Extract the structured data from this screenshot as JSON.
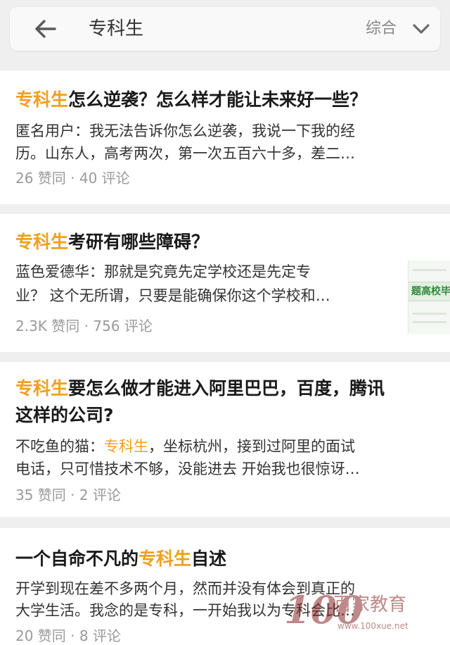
{
  "search": {
    "query": "专科生",
    "sort_label": "综合",
    "icons": {
      "back": "arrow-left-icon",
      "sort": "chevron-down-icon"
    }
  },
  "colors": {
    "highlight": "#f0a020",
    "meta": "#9a9a9a",
    "background": "#efefef"
  },
  "results": [
    {
      "title_highlight": "专科生",
      "title_rest": "怎么逆袭？怎么样才能让未来好一些？",
      "excerpt_line1": "匿名用户：我无法告诉你怎么逆袭，我说一下我的经",
      "excerpt_line2": "历。山东人，高考两次，第一次五百六十多，差二…",
      "meta": "26 赞同 · 40 评论"
    },
    {
      "title_highlight": "专科生",
      "title_rest": "考研有哪些障碍？",
      "excerpt_line1": "蓝色爱德华：那就是究竟先定学校还是先定专",
      "excerpt_line2": "业？ 这个无所谓，只要是能确保你这个学校和…",
      "meta": "2.3K 赞同 · 756 评论",
      "thumbnail_text": "题高校毕业"
    },
    {
      "title_highlight": "专科生",
      "title_rest_line1": "要怎么做才能进入阿里巴巴，百度，腾讯",
      "title_line2": "这样的公司?",
      "excerpt_prefix": "不吃鱼的猫：",
      "excerpt_highlight": "专科生",
      "excerpt_suffix": "，坐标杭州，接到过阿里的面试",
      "excerpt_line2": "电话，只可惜技术不够，没能进去 开始我也很惊讶…",
      "meta": "35 赞同 · 2 评论"
    },
    {
      "title_prefix": "一个自命不凡的",
      "title_highlight": "专科生",
      "title_suffix": "自述",
      "excerpt_line1": "开学到现在差不多两个月，然而并没有体会到真正的",
      "excerpt_line2": "大学生活。我念的是专科，一开始我以为专科会比…",
      "meta": "20 赞同 · 8 评论"
    }
  ],
  "watermark": {
    "number": "100",
    "name": "百家教育",
    "url": "www.100xue.net"
  }
}
